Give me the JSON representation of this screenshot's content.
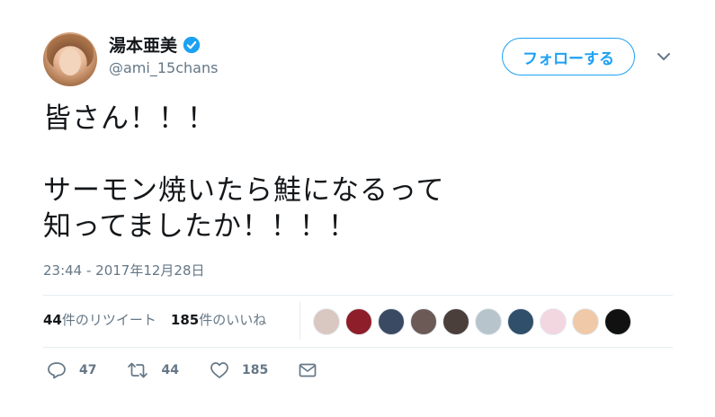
{
  "user": {
    "display_name": "湯本亜美",
    "handle": "@ami_15chans",
    "verified": true
  },
  "follow_label": "フォローする",
  "tweet": {
    "text": "皆さん！！！\n\nサーモン焼いたら鮭になるって\n知ってましたか！！！！",
    "timestamp": "23:44 - 2017年12月28日"
  },
  "stats": {
    "retweets_count": "44",
    "retweets_label": "件のリツイート",
    "likes_count": "185",
    "likes_label": "件のいいね"
  },
  "likers": [
    {
      "name": "liker-1",
      "color": "#d9c7c2"
    },
    {
      "name": "liker-2",
      "color": "#8e1e2a"
    },
    {
      "name": "liker-3",
      "color": "#3b4a63"
    },
    {
      "name": "liker-4",
      "color": "#6b5a55"
    },
    {
      "name": "liker-5",
      "color": "#4a3f3b"
    },
    {
      "name": "liker-6",
      "color": "#b8c4cc"
    },
    {
      "name": "liker-7",
      "color": "#2f4f6a"
    },
    {
      "name": "liker-8",
      "color": "#f2d6e0"
    },
    {
      "name": "liker-9",
      "color": "#f0c9a8"
    },
    {
      "name": "liker-10",
      "color": "#111111"
    }
  ],
  "actions": {
    "reply_count": "47",
    "retweet_count": "44",
    "like_count": "185"
  },
  "colors": {
    "accent": "#1da1f2",
    "secondary_text": "#657786",
    "divider": "#e6ecf0"
  }
}
